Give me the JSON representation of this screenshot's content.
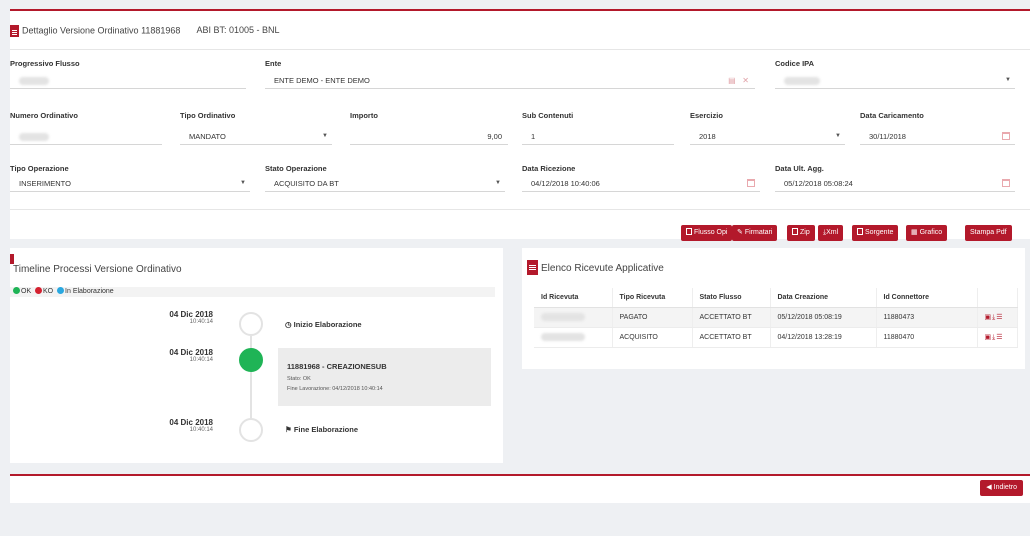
{
  "header": {
    "title": "Dettaglio Versione Ordinativo 11881968",
    "abi": "ABI BT: 01005 - BNL"
  },
  "form": {
    "progressivo_flusso": {
      "label": "Progressivo Flusso"
    },
    "ente": {
      "label": "Ente",
      "value": "ENTE DEMO - ENTE DEMO"
    },
    "codice_ipa": {
      "label": "Codice IPA"
    },
    "numero_ordinativo": {
      "label": "Numero Ordinativo"
    },
    "tipo_ordinativo": {
      "label": "Tipo Ordinativo",
      "value": "MANDATO"
    },
    "importo": {
      "label": "Importo",
      "value": "9,00"
    },
    "sub_contenuti": {
      "label": "Sub Contenuti",
      "value": "1"
    },
    "esercizio": {
      "label": "Esercizio",
      "value": "2018"
    },
    "data_caricamento": {
      "label": "Data Caricamento",
      "value": "30/11/2018"
    },
    "tipo_operazione": {
      "label": "Tipo Operazione",
      "value": "INSERIMENTO"
    },
    "stato_operazione": {
      "label": "Stato Operazione",
      "value": "ACQUISITO DA BT"
    },
    "data_ricezione": {
      "label": "Data Ricezione",
      "value": "04/12/2018 10:40:06"
    },
    "data_ult_agg": {
      "label": "Data Ult. Agg.",
      "value": "05/12/2018 05:08:24"
    }
  },
  "actions": {
    "flusso_opi": "Flusso Opi",
    "firmatari": "Firmatari",
    "zip": "Zip",
    "xml": "Xml",
    "sorgente": "Sorgente",
    "grafico": "Grafico",
    "stampa_pdf": "Stampa Pdf"
  },
  "timeline": {
    "title": "Timeline Processi Versione Ordinativo",
    "legend": {
      "ok": "OK",
      "ko": "KO",
      "in_elab": "In Elaborazione"
    },
    "colors": {
      "ok": "#1fb456",
      "ko": "#d42130",
      "in_elab": "#2aa8e0"
    },
    "items": [
      {
        "date": "04 Dic 2018",
        "time": "10:40:14",
        "label": "Inizio Elaborazione"
      },
      {
        "date": "04 Dic 2018",
        "time": "10:40:14",
        "label": "11881968 - CREAZIONESUB",
        "stato": "Stato: OK",
        "fine": "Fine Lavorazione: 04/12/2018 10:40:14"
      },
      {
        "date": "04 Dic 2018",
        "time": "10:40:14",
        "label": "Fine Elaborazione"
      }
    ]
  },
  "receipts": {
    "title": "Elenco Ricevute Applicative",
    "columns": [
      "Id Ricevuta",
      "Tipo Ricevuta",
      "Stato Flusso",
      "Data Creazione",
      "Id Connettore"
    ],
    "rows": [
      {
        "tipo": "PAGATO",
        "stato": "ACCETTATO BT",
        "data": "05/12/2018 05:08:19",
        "connettore": "11880473"
      },
      {
        "tipo": "ACQUISITO",
        "stato": "ACCETTATO BT",
        "data": "04/12/2018 13:28:19",
        "connettore": "11880470"
      }
    ]
  },
  "footer": {
    "back": "Indietro"
  },
  "theme": {
    "accent": "#b3192b"
  }
}
